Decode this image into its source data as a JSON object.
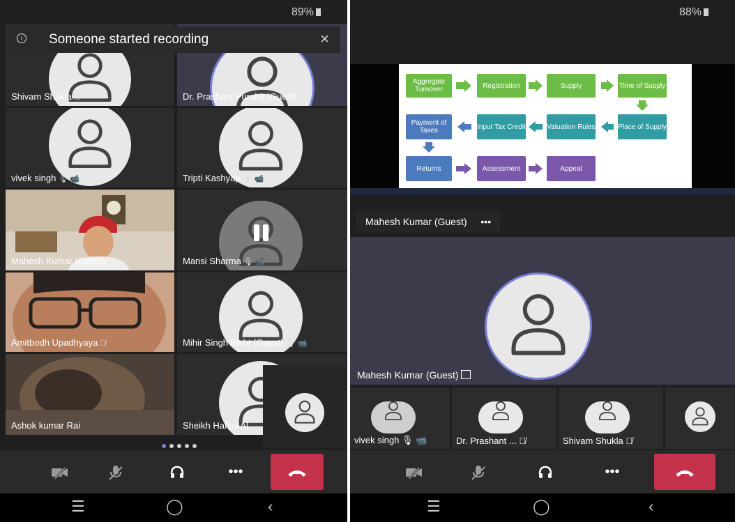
{
  "left_phone": {
    "battery": "89%",
    "toast": {
      "text": "Someone started recording",
      "close": "×"
    },
    "participants": [
      {
        "name": "Shivam Shukla",
        "icons": "🎙̸"
      },
      {
        "name": "Dr. Prashant Purohit (Guest)",
        "icons": ""
      },
      {
        "name": "vivek singh",
        "icons": "🎙 📹"
      },
      {
        "name": "Tripti Kashyap",
        "icons": "🎙 📹"
      },
      {
        "name": "Mahesh Kumar (Guest)",
        "icons": ""
      },
      {
        "name": "Mansi Sharma",
        "icons": "🎙 📹"
      },
      {
        "name": "Amitbodh Upadhyaya",
        "icons": "🎙̸"
      },
      {
        "name": "Mihir Singh Bisht (Guest)",
        "icons": "🎙 📹"
      },
      {
        "name": "Ashok kumar Rai",
        "icons": ""
      },
      {
        "name": "Sheikh Hafijul Al",
        "icons": ""
      }
    ],
    "page_count": 5,
    "active_page": 1
  },
  "right_phone": {
    "battery": "88%",
    "slide": {
      "row1": [
        "Aggregate Turnover",
        "Registration",
        "Supply",
        "Time of Supply"
      ],
      "row2": [
        "Payment of Taxes",
        "Input Tax Credit",
        "Valuation Rules",
        "Place of Supply"
      ],
      "row3": [
        "Returns",
        "Assessment",
        "Appeal"
      ]
    },
    "presenter_label": "Mahesh Kumar (Guest)",
    "presenter_more": "•••",
    "main_name": "Mahesh Kumar (Guest)",
    "strip": [
      {
        "name": "vivek singh",
        "icons": "🎙 📹"
      },
      {
        "name": "Dr. Prashant ...",
        "icons": "🎙̸"
      },
      {
        "name": "Shivam Shukla",
        "icons": "🎙̸"
      }
    ]
  },
  "controls": {
    "more": "•••"
  },
  "icons": {
    "camera": "camera-off-icon",
    "mic": "mic-off-icon",
    "audio": "headset-icon",
    "more": "more-icon",
    "hangup": "hang-up-icon"
  },
  "colors": {
    "accent": "#7b7fd8",
    "hangup": "#c4314b"
  }
}
